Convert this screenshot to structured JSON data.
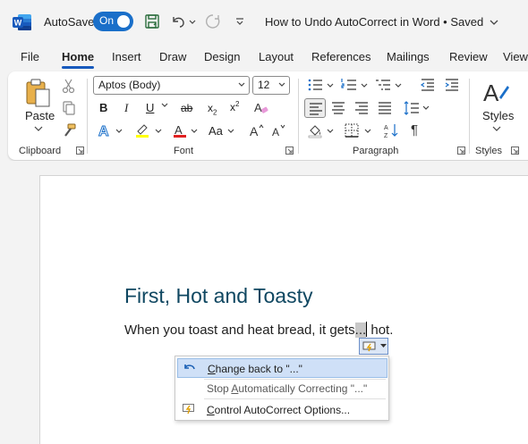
{
  "titlebar": {
    "autosave_label": "AutoSave",
    "autosave_state": "On",
    "document_title": "How to Undo AutoCorrect in Word • Saved",
    "icons": [
      "word-logo-icon",
      "save-icon",
      "undo-icon",
      "redo-icon",
      "customize-qat-icon",
      "chevron-down-icon"
    ]
  },
  "tabs": [
    {
      "label": "File"
    },
    {
      "label": "Home",
      "active": true
    },
    {
      "label": "Insert"
    },
    {
      "label": "Draw"
    },
    {
      "label": "Design"
    },
    {
      "label": "Layout"
    },
    {
      "label": "References"
    },
    {
      "label": "Mailings"
    },
    {
      "label": "Review"
    },
    {
      "label": "View"
    }
  ],
  "ribbon": {
    "clipboard": {
      "label": "Clipboard",
      "paste_label": "Paste"
    },
    "font": {
      "label": "Font",
      "font_name": "Aptos (Body)",
      "font_size": "12",
      "change_case_label": "Aa"
    },
    "paragraph": {
      "label": "Paragraph"
    },
    "styles": {
      "label": "Styles",
      "styles_button_label": "Styles"
    }
  },
  "document": {
    "heading": "First, Hot and Toasty",
    "body_before": "When you toast and heat bread, it gets",
    "body_selected": "...",
    "body_after": " hot."
  },
  "autocorrect_menu": {
    "items": [
      {
        "label_pre": "",
        "label_key": "C",
        "label_post": "hange back to \"...\"",
        "highlighted": true,
        "icon": "undo-arrow-icon"
      },
      {
        "label_pre": "Stop ",
        "label_key": "A",
        "label_post": "utomatically Correcting \"...\"",
        "highlighted": false
      },
      {
        "label_pre": "",
        "label_key": "C",
        "label_post": "ontrol AutoCorrect Options...",
        "highlighted": false,
        "icon": "autocorrect-lightning-icon"
      }
    ]
  },
  "colors": {
    "accent": "#185abd",
    "toggle": "#1a6fc9",
    "heading": "#0f4761",
    "highlight_yellow": "#ffff00",
    "font_color_red": "#e02020"
  }
}
